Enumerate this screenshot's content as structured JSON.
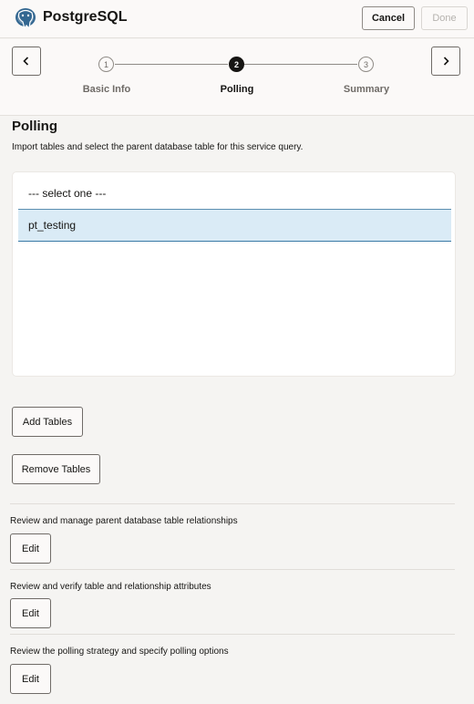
{
  "header": {
    "title": "PostgreSQL",
    "logo_icon": "postgresql-elephant-icon",
    "cancel_label": "Cancel",
    "done_label": "Done"
  },
  "train": {
    "prev_icon": "chevron-left-icon",
    "next_icon": "chevron-right-icon",
    "steps": [
      {
        "number": "1",
        "label": "Basic Info",
        "state": "visited"
      },
      {
        "number": "2",
        "label": "Polling",
        "state": "current"
      },
      {
        "number": "3",
        "label": "Summary",
        "state": "unvisited"
      }
    ]
  },
  "main": {
    "title": "Polling",
    "description": "Import tables and select the parent database table for this service query.",
    "list": {
      "placeholder": "--- select one ---",
      "items": [
        "pt_testing"
      ],
      "selected": "pt_testing"
    },
    "add_tables_label": "Add Tables",
    "remove_tables_label": "Remove Tables",
    "reviews": [
      {
        "text": "Review and manage parent database table relationships",
        "button": "Edit"
      },
      {
        "text": "Review and verify table and relationship attributes",
        "button": "Edit"
      },
      {
        "text": "Review the polling strategy and specify polling options",
        "button": "Edit"
      }
    ]
  },
  "colors": {
    "accent_selected_bg": "#daebf6",
    "accent_border": "#3a7aa6",
    "page_bg": "#f5f4f2",
    "active_step": "#161513"
  }
}
